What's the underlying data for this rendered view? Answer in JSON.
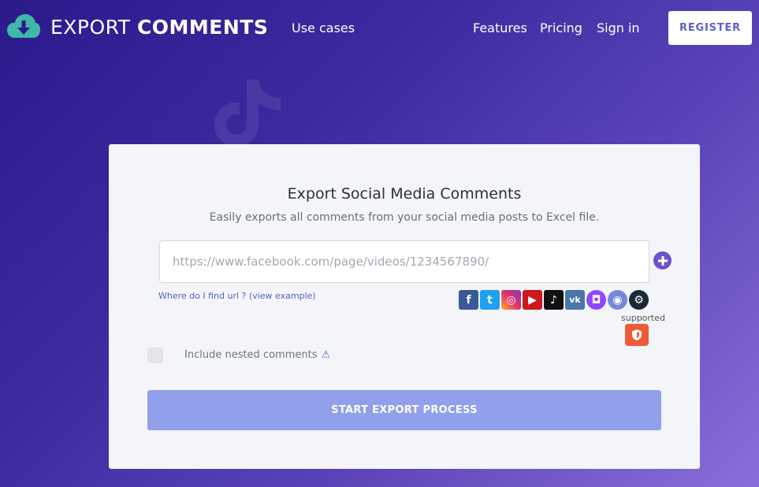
{
  "header": {
    "brand_light": "EXPORT ",
    "brand_bold": "COMMENTS",
    "nav": {
      "use_cases": "Use cases",
      "features": "Features",
      "pricing": "Pricing",
      "sign_in": "Sign in"
    },
    "register_label": "REGISTER"
  },
  "card": {
    "title": "Export Social Media Comments",
    "subtitle": "Easily exports all comments from your social media posts to Excel file.",
    "url_input": {
      "value": "",
      "placeholder": "https://www.facebook.com/page/videos/1234567890/"
    },
    "help_link": "Where do I find url ? (view example)",
    "supported_label": "supported",
    "platforms": [
      {
        "name": "facebook-icon",
        "glyph": "f",
        "color": "#3b5998"
      },
      {
        "name": "twitter-icon",
        "glyph": "t",
        "color": "#1da1f2"
      },
      {
        "name": "instagram-icon",
        "glyph": "◎",
        "color": "#d6249f"
      },
      {
        "name": "youtube-icon",
        "glyph": "▶",
        "color": "#cc181e"
      },
      {
        "name": "tiktok-icon",
        "glyph": "♪",
        "color": "#111111"
      },
      {
        "name": "vk-icon",
        "glyph": "vk",
        "color": "#4a76a8"
      },
      {
        "name": "twitch-icon",
        "glyph": "◘",
        "color": "#9146ff"
      },
      {
        "name": "discord-icon",
        "glyph": "◉",
        "color": "#7289da"
      },
      {
        "name": "steam-icon",
        "glyph": "⚙",
        "color": "#1b2838"
      }
    ],
    "nested_label": "Include nested comments",
    "nested_checked": false,
    "start_label": "START EXPORT PROCESS"
  },
  "colors": {
    "accent": "#6c52c9",
    "button": "#929fea",
    "shield": "#f05a3a",
    "logo": "#3fb8a8"
  }
}
